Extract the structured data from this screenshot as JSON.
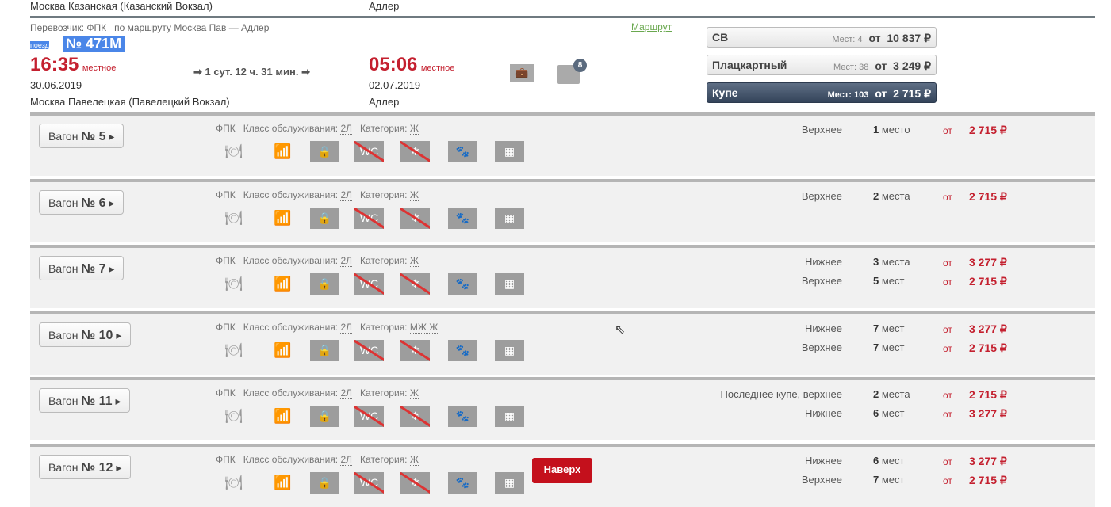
{
  "prev": {
    "from": "Москва Казанская (Казанский Вокзал)",
    "to": "Адлер"
  },
  "train": {
    "carrier_line": "Перевозчик: ФПК   по маршруту Москва Пав — Адлер",
    "route_link": "Маршрут",
    "train_label": "поезд",
    "number": "№ 471М",
    "dep_time": "16:35",
    "local": "местное",
    "dep_date": "30.06.2019",
    "dep_station": "Москва Павелецкая (Павелецкий Вокзал)",
    "duration": "1 сут. 12 ч. 31 мин.",
    "arr_time": "05:06",
    "arr_date": "02.07.2019",
    "arr_station": "Адлер",
    "luggage_badge": "8"
  },
  "classes": [
    {
      "name": "СВ",
      "seats": "Мест: 4",
      "from": "от",
      "price": "10 837 ₽",
      "active": false
    },
    {
      "name": "Плацкартный",
      "seats": "Мест: 38",
      "from": "от",
      "price": "3 249 ₽",
      "active": false
    },
    {
      "name": "Купе",
      "seats": "Мест: 103",
      "from": "от",
      "price": "2 715 ₽",
      "active": true
    }
  ],
  "labels": {
    "wagon": "Вагон",
    "carrier": "ФПК",
    "service": "Класс обслуживания:",
    "category": "Категория:",
    "from": "от",
    "to_top": "Наверх"
  },
  "cars": [
    {
      "num": "№ 5",
      "service": "2Л",
      "category": "Ж",
      "seats": [
        {
          "type": "Верхнее",
          "count": "1",
          "unit": "место",
          "price": "2 715 ₽"
        }
      ]
    },
    {
      "num": "№ 6",
      "service": "2Л",
      "category": "Ж",
      "seats": [
        {
          "type": "Верхнее",
          "count": "2",
          "unit": "места",
          "price": "2 715 ₽"
        }
      ]
    },
    {
      "num": "№ 7",
      "service": "2Л",
      "category": "Ж",
      "seats": [
        {
          "type": "Нижнее",
          "count": "3",
          "unit": "места",
          "price": "3 277 ₽"
        },
        {
          "type": "Верхнее",
          "count": "5",
          "unit": "мест",
          "price": "2 715 ₽"
        }
      ]
    },
    {
      "num": "№ 10",
      "service": "2Л",
      "category": "МЖ Ж",
      "seats": [
        {
          "type": "Нижнее",
          "count": "7",
          "unit": "мест",
          "price": "3 277 ₽"
        },
        {
          "type": "Верхнее",
          "count": "7",
          "unit": "мест",
          "price": "2 715 ₽"
        }
      ]
    },
    {
      "num": "№ 11",
      "service": "2Л",
      "category": "Ж",
      "seats": [
        {
          "type": "Последнее купе, верхнее",
          "count": "2",
          "unit": "места",
          "price": "2 715 ₽"
        },
        {
          "type": "Нижнее",
          "count": "6",
          "unit": "мест",
          "price": "3 277 ₽"
        }
      ]
    },
    {
      "num": "№ 12",
      "service": "2Л",
      "category": "Ж",
      "seats": [
        {
          "type": "Нижнее",
          "count": "6",
          "unit": "мест",
          "price": "3 277 ₽"
        },
        {
          "type": "Верхнее",
          "count": "7",
          "unit": "мест",
          "price": "2 715 ₽"
        }
      ]
    }
  ],
  "amenity_icons": [
    "meal-icon",
    "chart-icon",
    "bag-icon",
    "no-wc-icon",
    "no-ac-icon",
    "pets-icon",
    "linen-icon"
  ],
  "colors": {
    "price": "#c4202f",
    "active_class": "#3f4f66",
    "highlight": "#4a86e8",
    "up_button": "#c4101c"
  }
}
